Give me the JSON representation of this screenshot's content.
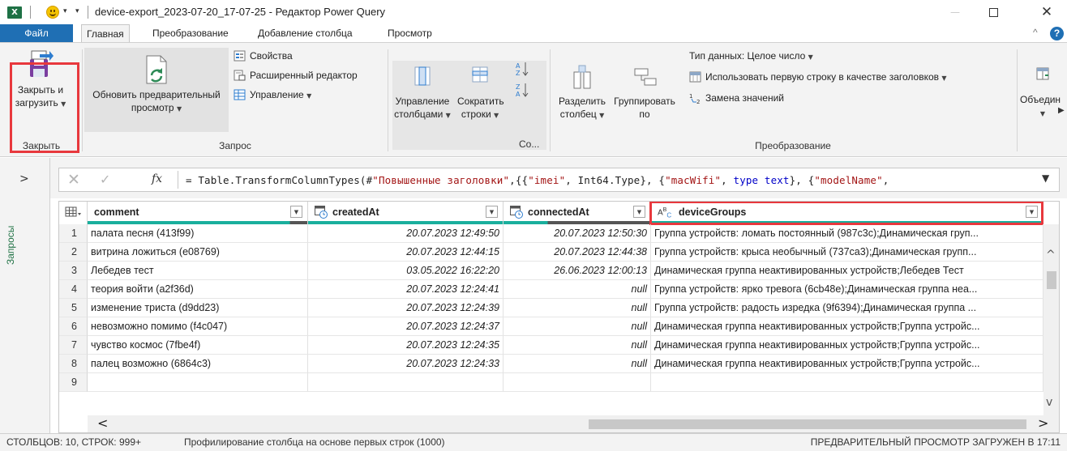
{
  "window": {
    "title": "device-export_2023-07-20_17-07-25 - Редактор Power Query",
    "app_icon": "X",
    "minimize": "—",
    "close": "✕"
  },
  "tabs": {
    "file": "Файл",
    "items": [
      "Главная",
      "Преобразование",
      "Добавление столбца",
      "Просмотр"
    ],
    "active": "Главная",
    "collapse_icon": "^",
    "help_icon": "?"
  },
  "ribbon": {
    "close_group": {
      "label": "Закрыть",
      "close_load_line1": "Закрыть и",
      "close_load_line2": "загрузить"
    },
    "query_group": {
      "label": "Запрос",
      "refresh_line1": "Обновить предварительный",
      "refresh_line2": "просмотр",
      "properties": "Свойства",
      "advanced_editor": "Расширенный редактор",
      "manage": "Управление"
    },
    "manage_columns": {
      "line1": "Управление",
      "line2": "столбцами"
    },
    "reduce_rows": {
      "line1": "Сократить",
      "line2": "строки"
    },
    "sort_group_label": "Со...",
    "transform_group": {
      "label": "Преобразование",
      "split_line1": "Разделить",
      "split_line2": "столбец",
      "group_line1": "Группировать",
      "group_line2": "по",
      "data_type": "Тип данных: Целое число",
      "use_first_row": "Использовать первую строку в качестве заголовков",
      "replace_values": "Замена значений"
    },
    "combine": {
      "label": "Объедин"
    }
  },
  "formula_bar": {
    "cancel_icon": "✕",
    "commit_icon": "✓",
    "fx": "fx",
    "prefix": "= Table.TransformColumnTypes(#",
    "s1": "\"Повышенные заголовки\"",
    "p2": ",{{",
    "s2": "\"imei\"",
    "p3": ", Int64.Type}, {",
    "s3": "\"macWifi\"",
    "p4": ", ",
    "kw1": "type text",
    "p5": "}, {",
    "s4": "\"modelName\"",
    "p6": ","
  },
  "queries_pane": {
    "label": "Запросы",
    "expand_icon": ">"
  },
  "grid": {
    "columns": [
      {
        "name": "comment",
        "type_icon": "table-icon"
      },
      {
        "name": "createdAt",
        "type_icon": "datetime-icon"
      },
      {
        "name": "connectedAt",
        "type_icon": "datetime-icon"
      },
      {
        "name": "deviceGroups",
        "type_icon": "text-type-icon",
        "type_label": "ABC"
      }
    ],
    "rows": [
      {
        "n": "1",
        "comment": "палата песня (413f99)",
        "createdAt": "20.07.2023 12:49:50",
        "connectedAt": "20.07.2023 12:50:30",
        "deviceGroups": "Группа устройств: ломать постоянный (987c3c);Динамическая груп..."
      },
      {
        "n": "2",
        "comment": "витрина ложиться (e08769)",
        "createdAt": "20.07.2023 12:44:15",
        "connectedAt": "20.07.2023 12:44:38",
        "deviceGroups": "Группа устройств: крыса необычный (737ca3);Динамическая групп..."
      },
      {
        "n": "3",
        "comment": "Лебедев тест",
        "createdAt": "03.05.2022 16:22:20",
        "connectedAt": "26.06.2023 12:00:13",
        "deviceGroups": "Динамическая группа неактивированных устройств;Лебедев Тест"
      },
      {
        "n": "4",
        "comment": "теория войти (a2f36d)",
        "createdAt": "20.07.2023 12:24:41",
        "connectedAt": "null",
        "deviceGroups": "Группа устройств: ярко тревога (6cb48e);Динамическая группа неа..."
      },
      {
        "n": "5",
        "comment": "изменение триста (d9dd23)",
        "createdAt": "20.07.2023 12:24:39",
        "connectedAt": "null",
        "deviceGroups": "Группа устройств: радость изредка (9f6394);Динамическая группа ..."
      },
      {
        "n": "6",
        "comment": "невозможно помимо (f4c047)",
        "createdAt": "20.07.2023 12:24:37",
        "connectedAt": "null",
        "deviceGroups": "Динамическая группа неактивированных устройств;Группа устройс..."
      },
      {
        "n": "7",
        "comment": "чувство космос (7fbe4f)",
        "createdAt": "20.07.2023 12:24:35",
        "connectedAt": "null",
        "deviceGroups": "Динамическая группа неактивированных устройств;Группа устройс..."
      },
      {
        "n": "8",
        "comment": "палец возможно (6864c3)",
        "createdAt": "20.07.2023 12:24:33",
        "connectedAt": "null",
        "deviceGroups": "Динамическая группа неактивированных устройств;Группа устройс..."
      },
      {
        "n": "9",
        "comment": "",
        "createdAt": "",
        "connectedAt": "",
        "deviceGroups": ""
      }
    ]
  },
  "status": {
    "counts": "СТОЛБЦОВ: 10, СТРОК: 999+",
    "profiling": "Профилирование столбца на основе первых строк (1000)",
    "loaded": "ПРЕДВАРИТЕЛЬНЫЙ ПРОСМОТР ЗАГРУЖЕН В 17:11"
  },
  "colors": {
    "accent": "#1f6fb4",
    "highlight_box": "#e8383d",
    "column_quality": "#1aaf9d",
    "excel_green": "#1e7145"
  }
}
